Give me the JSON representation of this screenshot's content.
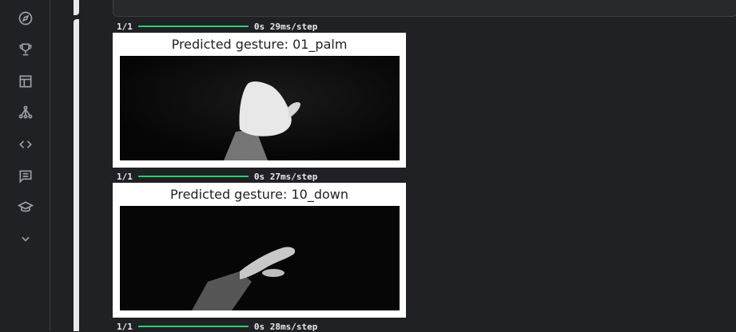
{
  "sidebar": {
    "items": [
      {
        "icon": "compass-icon"
      },
      {
        "icon": "trophy-icon"
      },
      {
        "icon": "table-icon"
      },
      {
        "icon": "models-icon"
      },
      {
        "icon": "code-icon"
      },
      {
        "icon": "discussion-icon"
      },
      {
        "icon": "learn-icon"
      },
      {
        "icon": "chevron-down-icon"
      }
    ]
  },
  "output": {
    "progress": [
      {
        "step": "1/1",
        "time": "0s 29ms/step"
      },
      {
        "step": "1/1",
        "time": "0s 27ms/step"
      },
      {
        "step": "1/1",
        "time": "0s 28ms/step"
      }
    ],
    "figures": [
      {
        "title": "Predicted gesture: 01_palm"
      },
      {
        "title": "Predicted gesture: 10_down"
      }
    ],
    "progress_color": "#2ecc71"
  }
}
